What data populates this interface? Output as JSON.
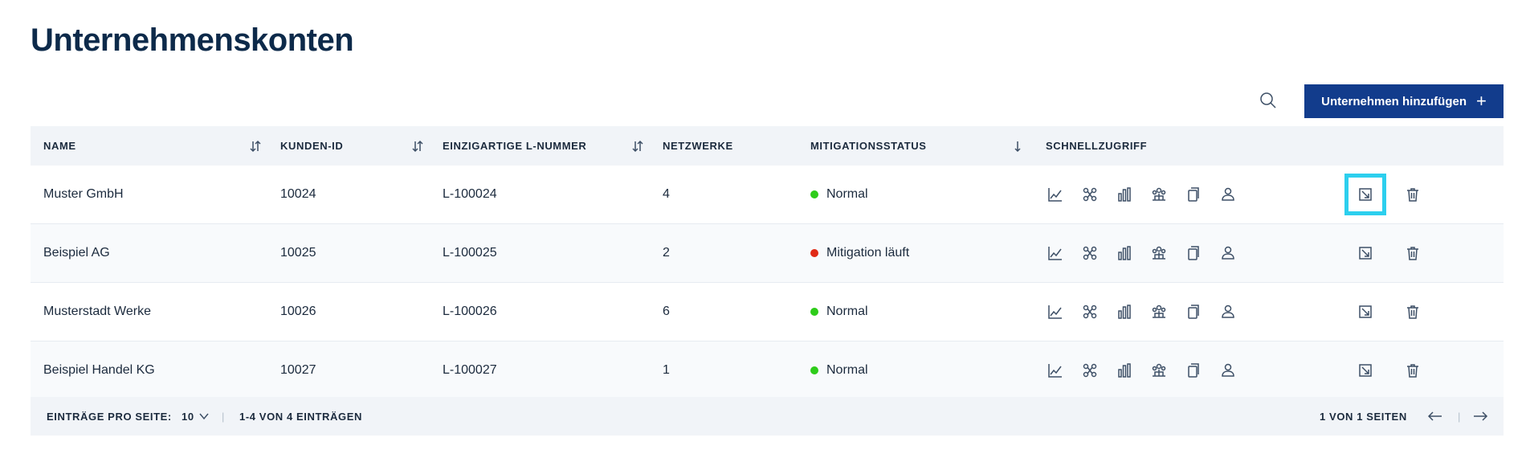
{
  "page": {
    "title": "Unternehmenskonten"
  },
  "toolbar": {
    "add_label": "Unternehmen hinzufügen",
    "add_icon": "plus-icon",
    "search_icon": "search-icon"
  },
  "table": {
    "headers": [
      "NAME",
      "KUNDEN-ID",
      "EINZIGARTIGE L-NUMMER",
      "NETZWERKE",
      "MITIGATIONSSTATUS",
      "SCHNELLZUGRIFF"
    ],
    "rows": [
      {
        "name": "Muster GmbH",
        "kunden_id": "10024",
        "l_nummer": "L-100024",
        "netzwerke": "4",
        "status": "Normal",
        "status_color": "#2ecc1a"
      },
      {
        "name": "Beispiel AG",
        "kunden_id": "10025",
        "l_nummer": "L-100025",
        "netzwerke": "2",
        "status": "Mitigation läuft",
        "status_color": "#e02a16"
      },
      {
        "name": "Musterstadt Werke",
        "kunden_id": "10026",
        "l_nummer": "L-100026",
        "netzwerke": "6",
        "status": "Normal",
        "status_color": "#2ecc1a"
      },
      {
        "name": "Beispiel Handel KG",
        "kunden_id": "10027",
        "l_nummer": "L-100027",
        "netzwerke": "1",
        "status": "Normal",
        "status_color": "#2ecc1a"
      }
    ],
    "quick_access_icons": [
      "line-chart-icon",
      "network-icon",
      "bar-chart-icon",
      "team-icon",
      "copy-icon",
      "user-icon"
    ],
    "action_icons": [
      "edit-icon",
      "delete-icon"
    ]
  },
  "footer": {
    "entries_label": "EINTRÄGE PRO SEITE:",
    "entries_value": "10",
    "range": "1-4 VON 4 EINTRÄGEN",
    "pages": "1 VON 1 SEITEN"
  },
  "colors": {
    "accent": "#123c8c",
    "highlight": "#2ccfee",
    "header_bg": "#f1f4f8"
  }
}
